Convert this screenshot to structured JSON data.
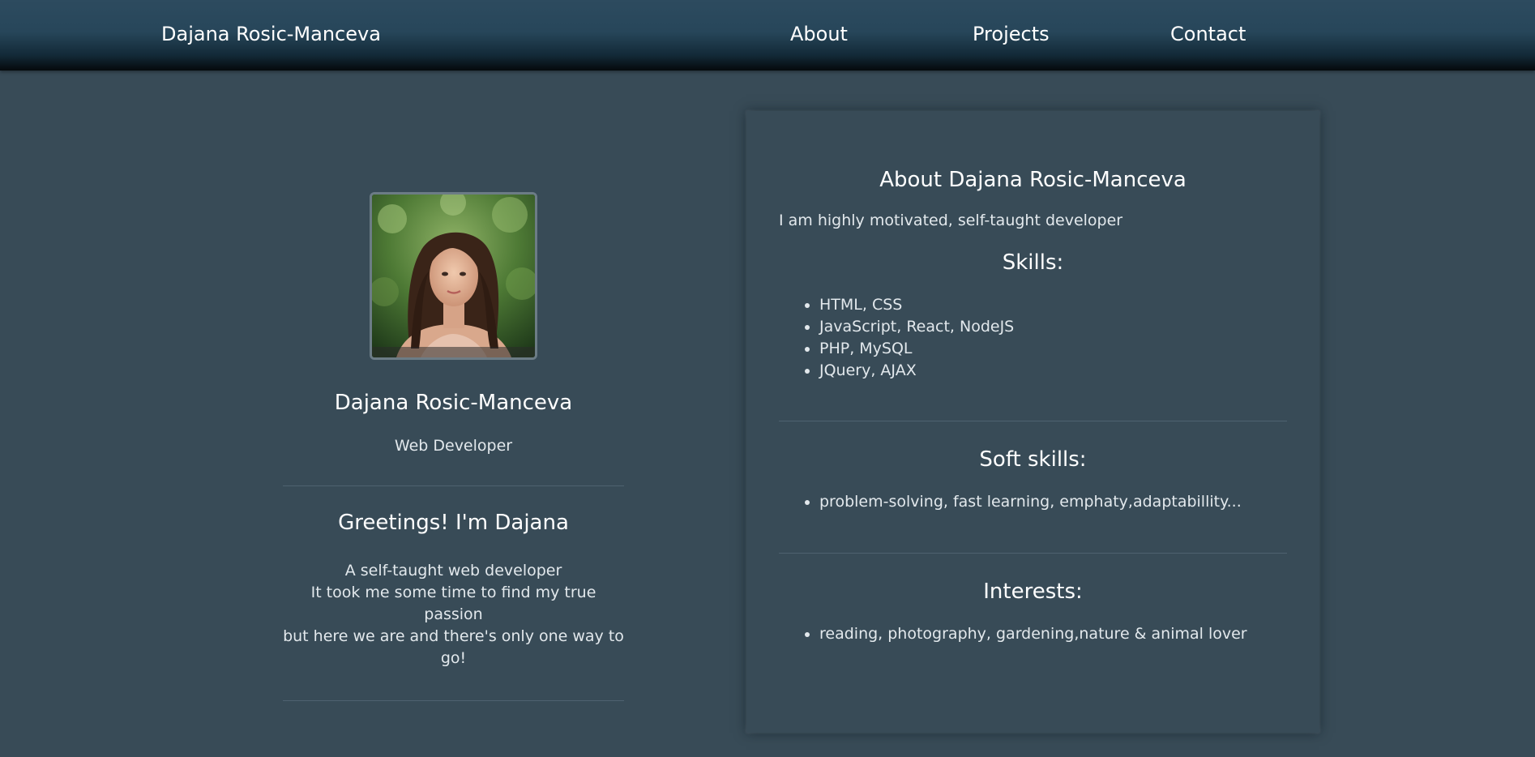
{
  "nav": {
    "brand": "Dajana Rosic-Manceva",
    "links": [
      "About",
      "Projects",
      "Contact"
    ]
  },
  "profile": {
    "name": "Dajana Rosic-Manceva",
    "role": "Web Developer",
    "greeting": "Greetings! I'm Dajana",
    "intro_lines": [
      "A self-taught web developer",
      "It took me some time to find my true passion",
      "but here we are and there's only one way to go!"
    ]
  },
  "about": {
    "title": "About Dajana Rosic-Manceva",
    "summary": "I am highly motivated, self-taught developer",
    "skills_title": "Skills:",
    "skills": [
      "HTML, CSS",
      "JavaScript, React, NodeJS",
      "PHP, MySQL",
      "JQuery, AJAX"
    ],
    "soft_title": "Soft skills:",
    "soft_skills": [
      "problem-solving, fast learning, emphaty,adaptabillity..."
    ],
    "interests_title": "Interests:",
    "interests": [
      "reading, photography, gardening,nature & animal lover"
    ]
  },
  "colors": {
    "page_background": "#384b57",
    "nav_top": "#2d4b5f",
    "nav_bottom": "#05090c",
    "text": "#ffffff",
    "muted_text": "#e2e8ec",
    "divider": "#4e6270"
  },
  "icons": {
    "avatar": "profile-photo"
  }
}
